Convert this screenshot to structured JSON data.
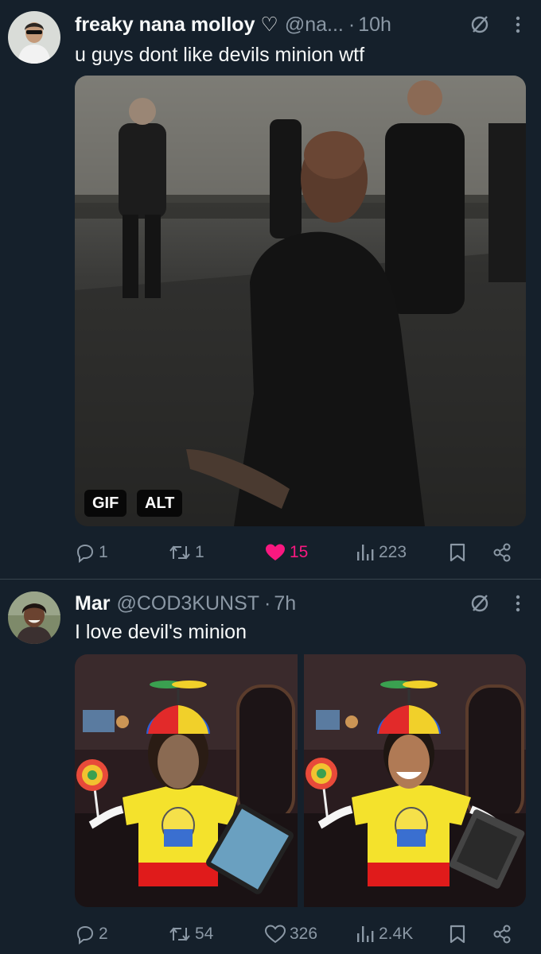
{
  "tweets": [
    {
      "author_name": "freaky nana molloy ♡",
      "handle": "@na...",
      "dot": "·",
      "time": "10h",
      "text": "u guys dont like devils minion wtf",
      "media_badges": {
        "gif": "GIF",
        "alt": "ALT"
      },
      "actions": {
        "replies": "1",
        "reposts": "1",
        "likes": "15",
        "liked": true,
        "views": "223"
      }
    },
    {
      "author_name": "Mar",
      "handle": "@COD3KUNST",
      "dot": "·",
      "time": "7h",
      "text": "I love devil's minion",
      "actions": {
        "replies": "2",
        "reposts": "54",
        "likes": "326",
        "liked": false,
        "views": "2.4K"
      }
    }
  ],
  "colors": {
    "background": "#15202b",
    "secondary_text": "#8b98a5",
    "like_pink": "#f91880",
    "divider": "#38444d"
  }
}
